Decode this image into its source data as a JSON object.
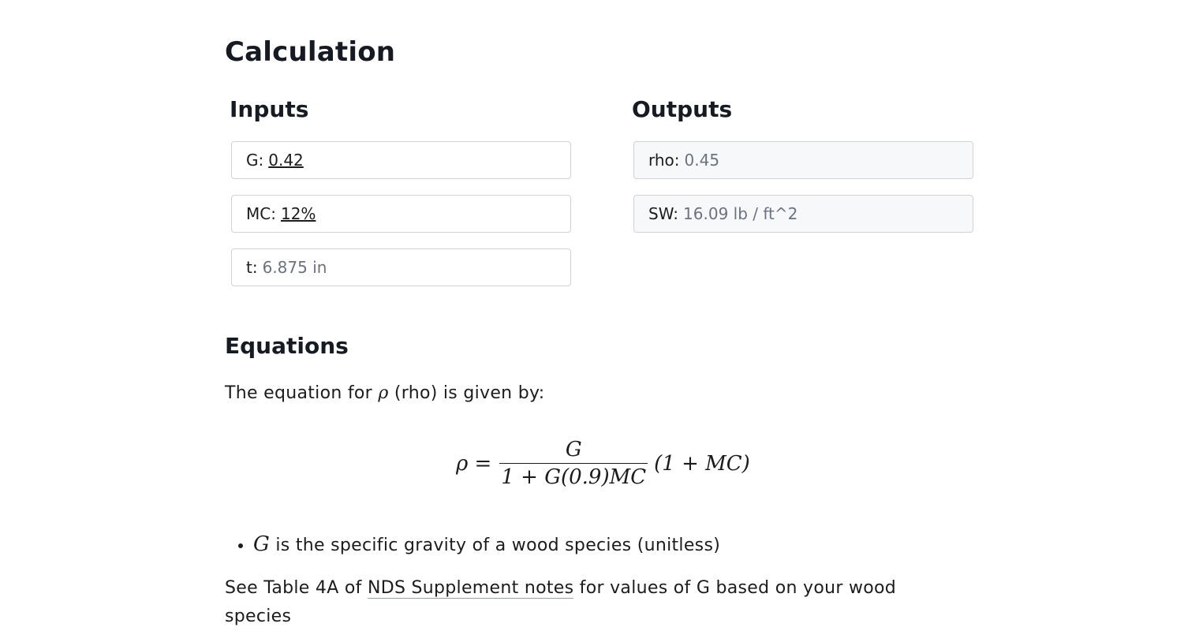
{
  "calculation": {
    "title": "Calculation",
    "inputs": {
      "title": "Inputs",
      "fields": [
        {
          "label": "G:",
          "value": "0.42"
        },
        {
          "label": "MC:",
          "value": "12%"
        },
        {
          "label": "t:",
          "value": "6.875 in"
        }
      ]
    },
    "outputs": {
      "title": "Outputs",
      "fields": [
        {
          "label": "rho:",
          "value": "0.45"
        },
        {
          "label": "SW:",
          "value": "16.09 lb / ft^2"
        }
      ]
    }
  },
  "equations": {
    "title": "Equations",
    "intro_before": "The equation for",
    "intro_symbol": "ρ",
    "intro_after": "(rho) is given by:",
    "formula": {
      "lhs": "ρ =",
      "numerator": "G",
      "denominator": "1 + G(0.9)MC",
      "factor": "(1 + MC)"
    },
    "bullets": [
      {
        "symbol": "G",
        "text": "is the specific gravity of a wood species (unitless)"
      }
    ],
    "note_before": "See Table 4A of",
    "note_link": "NDS Supplement notes",
    "note_after": "for values of G based on your wood species"
  }
}
